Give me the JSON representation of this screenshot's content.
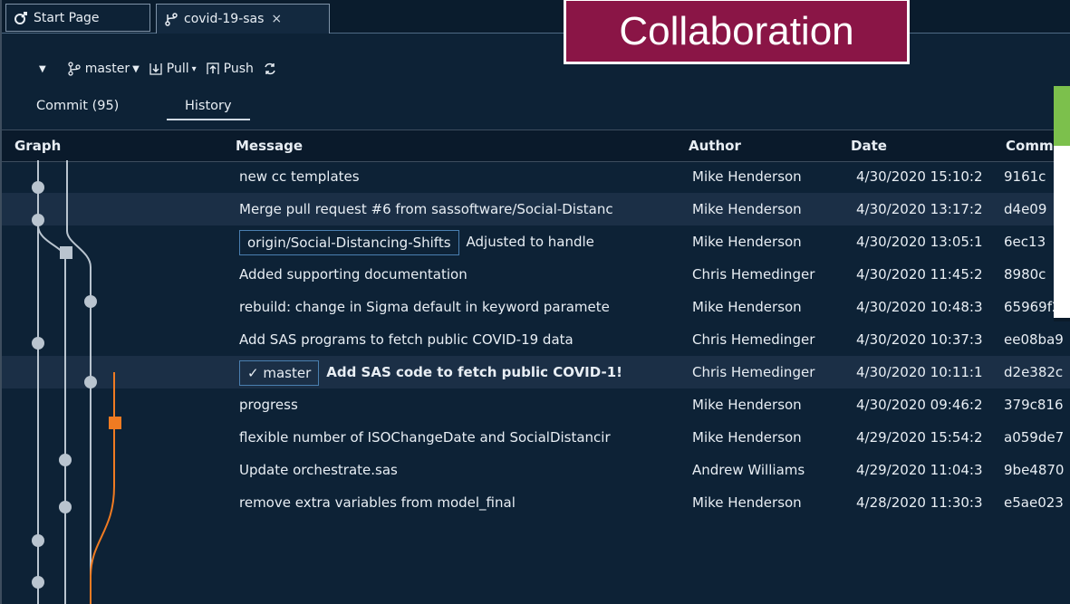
{
  "slide_label": "Collaboration",
  "tabs": [
    {
      "label": "Start Page",
      "icon": "team-explorer-icon"
    },
    {
      "label": "covid-19-sas",
      "icon": "git-branch-icon",
      "close": "×"
    }
  ],
  "toolbar": {
    "branch": "master",
    "pull": "Pull",
    "push": "Push"
  },
  "subtabs": {
    "commit": "Commit (95)",
    "history": "History"
  },
  "columns": {
    "graph": "Graph",
    "message": "Message",
    "author": "Author",
    "date": "Date",
    "commit": "Comm"
  },
  "rows": [
    {
      "message": "new cc templates",
      "author": "Mike Henderson",
      "date": "4/30/2020 15:10:2",
      "commit": "9161c"
    },
    {
      "message": "Merge pull request #6 from sassoftware/Social-Distanc",
      "author": "Mike Henderson",
      "date": "4/30/2020 13:17:2",
      "commit": "d4e09"
    },
    {
      "ref": "origin/Social-Distancing-Shifts",
      "message": "Adjusted to handle",
      "author": "Mike Henderson",
      "date": "4/30/2020 13:05:1",
      "commit": "6ec13"
    },
    {
      "message": "Added supporting documentation",
      "author": "Chris Hemedinger",
      "date": "4/30/2020 11:45:2",
      "commit": "8980c"
    },
    {
      "message": "rebuild: change in Sigma default in keyword paramete",
      "author": "Mike Henderson",
      "date": "4/30/2020 10:48:3",
      "commit": "65969f2"
    },
    {
      "message": "Add SAS programs to fetch public COVID-19 data",
      "author": "Chris Hemedinger",
      "date": "4/30/2020 10:37:3",
      "commit": "ee08ba9"
    },
    {
      "ref": "✓ master",
      "message": "Add SAS code to fetch public COVID-1!",
      "author": "Chris Hemedinger",
      "date": "4/30/2020 10:11:1",
      "commit": "d2e382c"
    },
    {
      "message": "progress",
      "author": "Mike Henderson",
      "date": "4/30/2020 09:46:2",
      "commit": "379c816"
    },
    {
      "message": "flexible number of ISOChangeDate and SocialDistancir",
      "author": "Mike Henderson",
      "date": "4/29/2020 15:54:2",
      "commit": "a059de7"
    },
    {
      "message": "Update orchestrate.sas",
      "author": "Andrew Williams",
      "date": "4/29/2020 11:04:3",
      "commit": "9be4870"
    },
    {
      "message": "remove extra variables from model_final",
      "author": "Mike Henderson",
      "date": "4/28/2020 11:30:3",
      "commit": "e5ae023"
    }
  ],
  "colors": {
    "graph_line": "#b9c4cf",
    "graph_accent": "#f07b22",
    "highlight_row": "#1b2f46",
    "banner": "#8a1546",
    "toast_accent": "#7cc04c"
  }
}
